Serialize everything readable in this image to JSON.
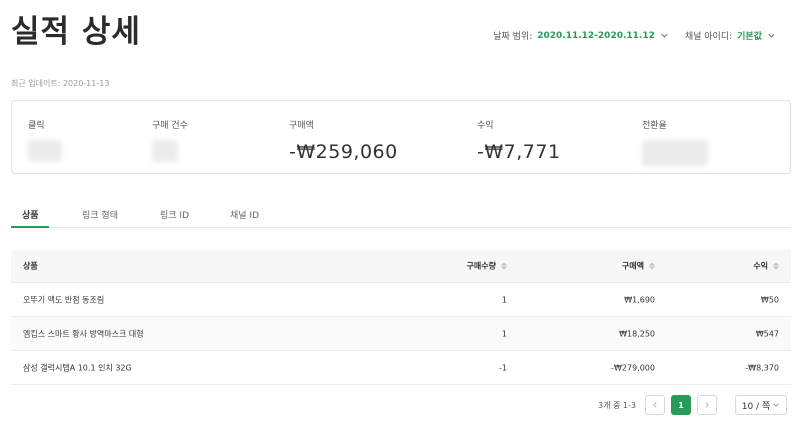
{
  "header": {
    "title": "실적 상세",
    "date_range_label": "날짜 범위:",
    "date_range_value": "2020.11.12-2020.11.12",
    "channel_label": "채널 아이디:",
    "channel_value": "기본값"
  },
  "updated": "최근 업데이트: 2020-11-13",
  "summary": {
    "clicks_label": "클릭",
    "orders_label": "구매 건수",
    "amount_label": "구매액",
    "amount_value": "-₩259,060",
    "revenue_label": "수익",
    "revenue_value": "-₩7,771",
    "conversion_label": "전환율"
  },
  "tabs": [
    "상품",
    "링크 형태",
    "링크 ID",
    "채널 ID"
  ],
  "table": {
    "headers": {
      "product": "상품",
      "qty": "구매수량",
      "amount": "구매액",
      "revenue": "수익"
    },
    "rows": [
      {
        "product": "오뚜기 맥도 반점 동조림",
        "qty": "1",
        "amount": "₩1,690",
        "revenue": "₩50"
      },
      {
        "product": "엠킵스 스마트 황사 방역마스크 대형",
        "qty": "1",
        "amount": "₩18,250",
        "revenue": "₩547"
      },
      {
        "product": "삼성 갤럭시탭A 10.1 인치 32G",
        "qty": "-1",
        "amount": "-₩279,000",
        "revenue": "-₩8,370"
      }
    ]
  },
  "pagination": {
    "total": "3개 중 1-3",
    "current_page": "1",
    "prev_icon": "chevron-left-icon",
    "next_icon": "chevron-right-icon",
    "page_size": "10 / 쪽"
  },
  "colors": {
    "accent": "#2a9a57"
  }
}
